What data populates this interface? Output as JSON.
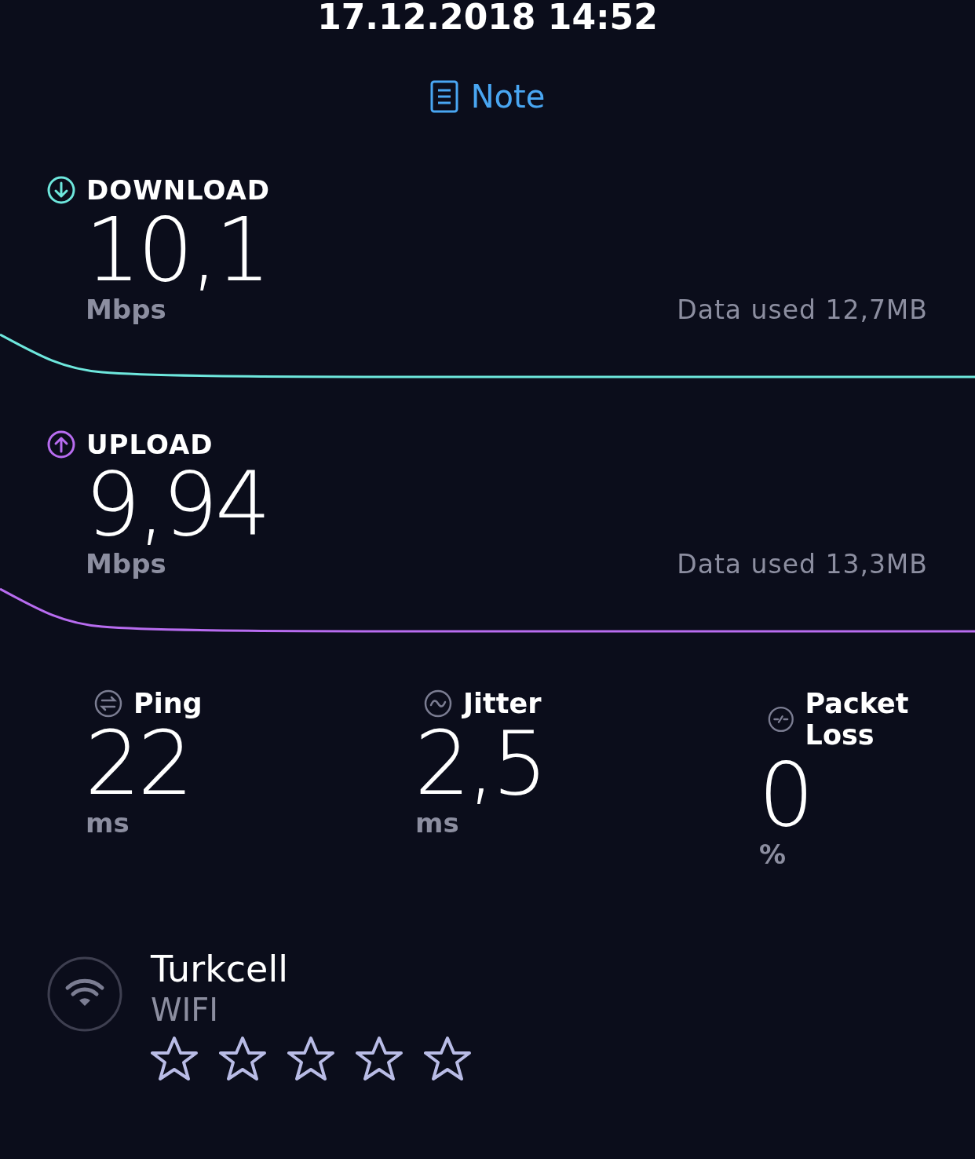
{
  "date": "17.12.2018 14:52",
  "note_button": {
    "label": "Note"
  },
  "speeds": [
    {
      "kind": "download",
      "label": "DOWNLOAD",
      "color": "#6ee7dd",
      "value": "10,1",
      "unit": "Mbps",
      "data_used": "Data used 12,7MB"
    },
    {
      "kind": "upload",
      "label": "UPLOAD",
      "color": "#b86cf0",
      "value": "9,94",
      "unit": "Mbps",
      "data_used": "Data used 13,3MB"
    }
  ],
  "stats": [
    {
      "kind": "ping",
      "label": "Ping",
      "value": "22",
      "unit": "ms"
    },
    {
      "kind": "jitter",
      "label": "Jitter",
      "value": "2,5",
      "unit": "ms"
    },
    {
      "kind": "loss",
      "label": "Packet Loss",
      "value": "0",
      "unit": "%"
    }
  ],
  "network": {
    "name": "Turkcell",
    "type": "WIFI",
    "stars": 0
  }
}
